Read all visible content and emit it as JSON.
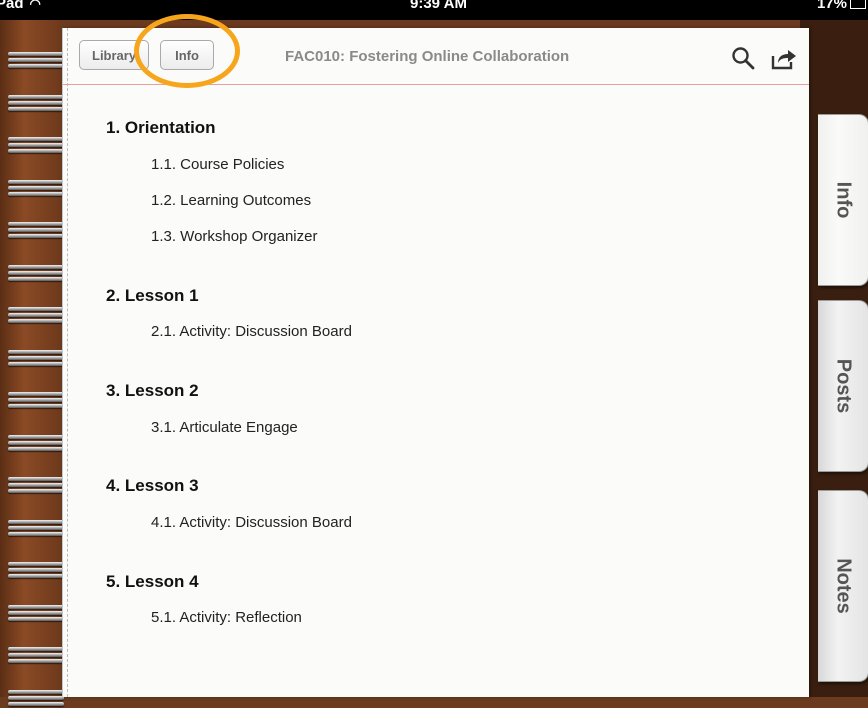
{
  "status_bar": {
    "device": "Pad",
    "time": "9:39 AM",
    "battery": "17%"
  },
  "toolbar": {
    "library_label": "Library",
    "info_label": "Info",
    "title": "FAC010: Fostering Online Collaboration",
    "highlight_color": "#f7a61b",
    "icons": [
      "search-icon",
      "share-icon"
    ]
  },
  "side_tabs": [
    {
      "label": "Info"
    },
    {
      "label": "Posts"
    },
    {
      "label": "Notes"
    }
  ],
  "toc": {
    "sections": [
      {
        "title": "1. Orientation",
        "items": [
          "1.1. Course Policies",
          "1.2. Learning Outcomes",
          "1.3. Workshop Organizer"
        ]
      },
      {
        "title": "2. Lesson 1",
        "items": [
          "2.1. Activity: Discussion Board"
        ]
      },
      {
        "title": "3. Lesson 2",
        "items": [
          "3.1. Articulate Engage"
        ]
      },
      {
        "title": "4. Lesson 3",
        "items": [
          "4.1. Activity: Discussion Board"
        ]
      },
      {
        "title": "5. Lesson 4",
        "items": [
          "5.1. Activity: Reflection"
        ]
      }
    ]
  }
}
